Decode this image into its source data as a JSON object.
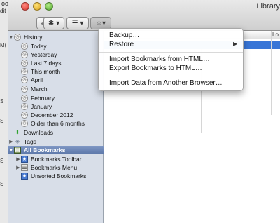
{
  "background": {
    "top_fragment": "oomgren",
    "left_fragments": [
      "dit",
      "M(",
      "S",
      "S",
      "S",
      "S"
    ]
  },
  "window": {
    "title": "Library",
    "toolbar": {
      "back_icon": "back-arrow-icon",
      "forward_icon": "forward-arrow-icon",
      "organize_icon": "gear-icon",
      "views_icon": "list-icon",
      "import_icon": "star-icon"
    }
  },
  "sidebar": {
    "history": {
      "label": "History",
      "children": [
        "Today",
        "Yesterday",
        "Last 7 days",
        "This month",
        "April",
        "March",
        "February",
        "January",
        "December 2012",
        "Older than 6 months"
      ]
    },
    "downloads": "Downloads",
    "tags": "Tags",
    "all_bookmarks": {
      "label": "All Bookmarks",
      "children": [
        "Bookmarks Toolbar",
        "Bookmarks Menu",
        "Unsorted Bookmarks"
      ]
    }
  },
  "content": {
    "columns": [
      "Lo"
    ]
  },
  "menu": {
    "items": [
      {
        "label": "Backup…",
        "submenu": false
      },
      {
        "label": "Restore",
        "submenu": true
      },
      {
        "label": "Import Bookmarks from HTML…",
        "submenu": false
      },
      {
        "label": "Export Bookmarks to HTML…",
        "submenu": false
      },
      {
        "label": "Import Data from Another Browser…",
        "submenu": false
      }
    ]
  },
  "colors": {
    "selection": "#3875d7",
    "sidebar_bg": "#d8dee8",
    "sidebar_selection": "#5c77a9"
  }
}
